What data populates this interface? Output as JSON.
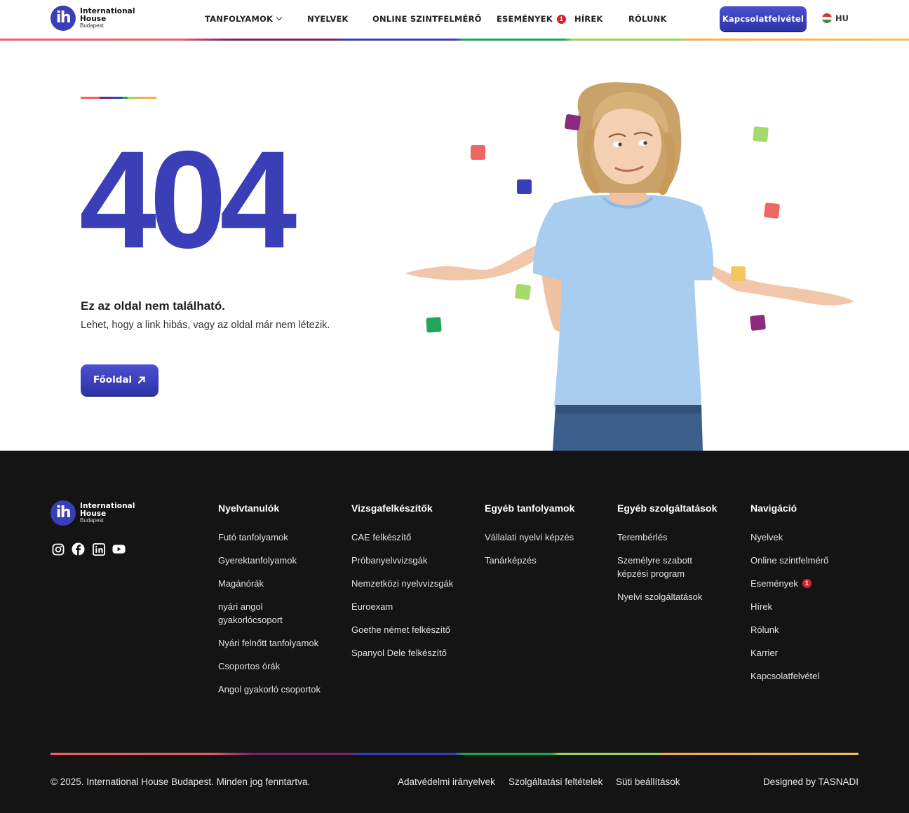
{
  "header": {
    "logo": {
      "line1": "International",
      "line2": "House",
      "line3": "Budapest",
      "mark": "ih"
    },
    "nav": [
      {
        "label": "TANFOLYAMOK"
      },
      {
        "label": "NYELVEK"
      },
      {
        "label": "ONLINE SZINTFELMÉRŐ"
      },
      {
        "label": "ESEMÉNYEK",
        "badge": "1"
      },
      {
        "label": "HÍREK"
      },
      {
        "label": "RÓLUNK"
      }
    ],
    "cta_label": "Kapcsolatfelvétel",
    "language": "HU"
  },
  "hero": {
    "code": "404",
    "title": "Ez az oldal nem található.",
    "subtitle": "Lehet, hogy a link hibás, vagy az oldal már nem létezik.",
    "home_button": "Főoldal"
  },
  "footer": {
    "logo": {
      "line1": "International",
      "line2": "House",
      "line3": "Budapest",
      "mark": "ih"
    },
    "socials": [
      "instagram-icon",
      "facebook-icon",
      "linkedin-icon",
      "youtube-icon"
    ],
    "columns": [
      {
        "title": "Nyelvtanulók",
        "items": [
          "Futó tanfolyamok",
          "Gyerektanfolyamok",
          "Magánórák",
          "nyári angol gyakorlócsoport",
          "Nyári felnőtt tanfolyamok",
          "Csoportos órák",
          "Angol gyakorló csoportok"
        ]
      },
      {
        "title": "Vizsgafelkészítők",
        "items": [
          "CAE felkészítő",
          "Próbanyelvvizsgák",
          "Nemzetközi nyelvvizsgák",
          "Euroexam",
          "Goethe német felkészítő",
          "Spanyol Dele felkészítő"
        ]
      },
      {
        "title": "Egyéb tanfolyamok",
        "items": [
          "Vállalati nyelvi képzés",
          "Tanárképzés"
        ]
      },
      {
        "title": "Egyéb szolgáltatások",
        "items": [
          "Terembérlés",
          "Személyre szabott képzési program",
          "Nyelvi szolgáltatások"
        ]
      },
      {
        "title": "Navigáció",
        "items": [
          "Nyelvek",
          "Online szintfelmérő",
          "Események",
          "Hírek",
          "Rólunk",
          "Karrier",
          "Kapcsolatfelvétel"
        ],
        "events_badge": "1"
      }
    ],
    "copyright": "© 2025. International House Budapest. Minden jog fenntartva.",
    "legal": [
      "Adatvédelmi irányelvek",
      "Szolgáltatási feltételek",
      "Süti beállítások"
    ],
    "designed_by": "Designed by TASNADI"
  },
  "colors": {
    "brand_blue": "#3a3fb8",
    "footer_bg": "#141414",
    "badge_red": "#d8222b"
  }
}
